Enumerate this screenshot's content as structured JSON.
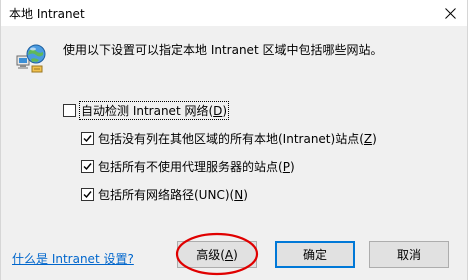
{
  "window": {
    "title": "本地 Intranet",
    "close_symbol": "×"
  },
  "main": {
    "description": "使用以下设置可以指定本地 Intranet 区域中包括哪些网站。"
  },
  "options": {
    "auto_detect": {
      "label": "自动检测 Intranet 网络",
      "access_key": "D",
      "checked": false
    },
    "local_sites": {
      "label": "包括没有列在其他区域的所有本地(Intranet)站点",
      "access_key": "Z",
      "checked": true
    },
    "bypass_proxy": {
      "label": "包括所有不使用代理服务器的站点",
      "access_key": "P",
      "checked": true
    },
    "unc_paths": {
      "label": "包括所有网络路径(UNC)",
      "access_key": "N",
      "checked": true
    }
  },
  "footer": {
    "help_link": "什么是 Intranet 设置?",
    "advanced_label": "高级",
    "advanced_key": "A",
    "ok_label": "确定",
    "cancel_label": "取消"
  },
  "colors": {
    "accent": "#0078d7",
    "link": "#0066cc",
    "annotation": "#e00000"
  },
  "icons": {
    "window": "network-globe-icon",
    "close": "close-icon",
    "check": "checkmark-icon"
  }
}
